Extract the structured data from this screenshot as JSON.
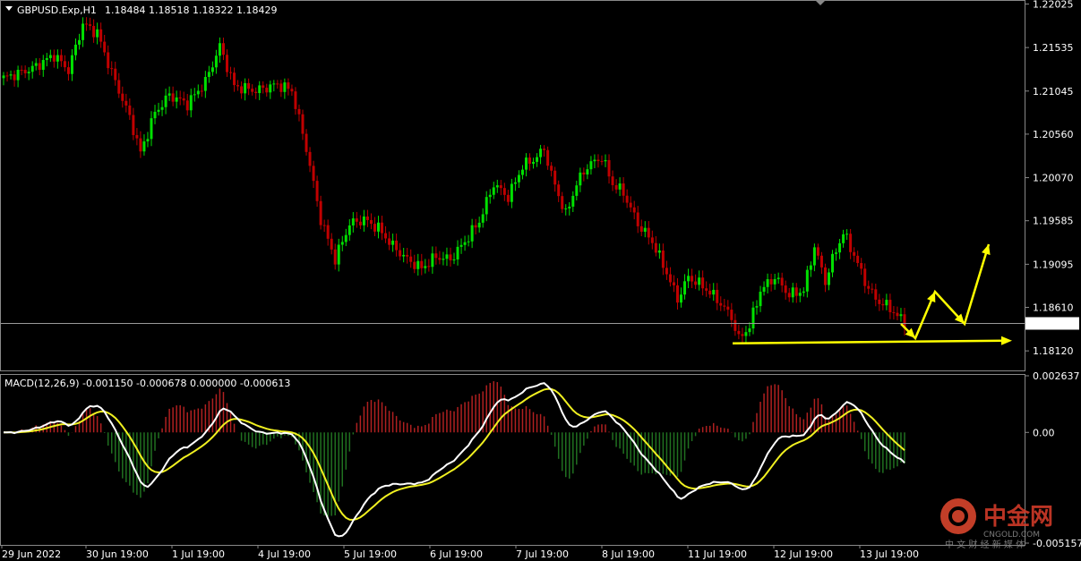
{
  "header": {
    "symbol": "GBPUSD.Exp,H1",
    "ohlc": "1.18484 1.18518 1.18322 1.18429"
  },
  "macd_header": "MACD(12,26,9) -0.001150 -0.000678 0.000000 -0.000613",
  "watermark": {
    "brand_cn": "中金网",
    "brand_en": "CNGOLD.COM",
    "tagline_cn": "中 文 财 经 新 媒 体"
  },
  "colors": {
    "background": "#000000",
    "bull_candle": "#00e000",
    "bear_candle": "#c00000",
    "macd_line": "#ffffff",
    "signal_line": "#f0f020",
    "hist_pos": "#b02020",
    "hist_neg": "#207020",
    "arrows": "#ffff00",
    "watermark": "#e04030"
  },
  "chart_data": [
    {
      "type": "candlestick",
      "title": "GBPUSD.Exp,H1",
      "y_ticks": [
        "1.22025",
        "1.21535",
        "1.21045",
        "1.20560",
        "1.20070",
        "1.19585",
        "1.19095",
        "1.18610",
        "1.18120"
      ],
      "ylim": [
        1.1792,
        1.2205
      ],
      "current_price": "1.18429",
      "x_ticks": [
        "29 Jun 2022",
        "30 Jun 19:00",
        "1 Jul 19:00",
        "4 Jul 19:00",
        "5 Jul 19:00",
        "6 Jul 19:00",
        "7 Jul 19:00",
        "8 Jul 19:00",
        "11 Jul 19:00",
        "12 Jul 19:00",
        "13 Jul 19:00"
      ],
      "anchors": [
        [
          0,
          1.2119
        ],
        [
          8,
          1.213
        ],
        [
          14,
          1.2145
        ],
        [
          18,
          1.2128
        ],
        [
          22,
          1.218
        ],
        [
          26,
          1.217
        ],
        [
          30,
          1.2125
        ],
        [
          35,
          1.2075
        ],
        [
          38,
          1.2035
        ],
        [
          42,
          1.208
        ],
        [
          46,
          1.21
        ],
        [
          51,
          1.209
        ],
        [
          56,
          1.2115
        ],
        [
          60,
          1.2155
        ],
        [
          64,
          1.211
        ],
        [
          70,
          1.2105
        ],
        [
          76,
          1.2112
        ],
        [
          80,
          1.2105
        ],
        [
          84,
          1.204
        ],
        [
          88,
          1.196
        ],
        [
          92,
          1.1915
        ],
        [
          96,
          1.1955
        ],
        [
          100,
          1.196
        ],
        [
          104,
          1.195
        ],
        [
          108,
          1.193
        ],
        [
          112,
          1.1915
        ],
        [
          116,
          1.1905
        ],
        [
          120,
          1.1918
        ],
        [
          124,
          1.1915
        ],
        [
          128,
          1.1935
        ],
        [
          132,
          1.1958
        ],
        [
          136,
          1.2
        ],
        [
          140,
          1.1985
        ],
        [
          144,
          1.202
        ],
        [
          148,
          1.203
        ],
        [
          150,
          1.204
        ],
        [
          152,
          1.201
        ],
        [
          156,
          1.1965
        ],
        [
          159,
          1.2
        ],
        [
          162,
          1.202
        ],
        [
          166,
          1.203
        ],
        [
          169,
          1.2
        ],
        [
          172,
          1.199
        ],
        [
          176,
          1.1955
        ],
        [
          180,
          1.1935
        ],
        [
          184,
          1.19
        ],
        [
          187,
          1.187
        ],
        [
          190,
          1.1895
        ],
        [
          194,
          1.1885
        ],
        [
          198,
          1.187
        ],
        [
          202,
          1.185
        ],
        [
          204,
          1.1825
        ],
        [
          207,
          1.184
        ],
        [
          210,
          1.188
        ],
        [
          214,
          1.1895
        ],
        [
          218,
          1.1875
        ],
        [
          222,
          1.188
        ],
        [
          225,
          1.193
        ],
        [
          228,
          1.189
        ],
        [
          230,
          1.1915
        ],
        [
          233,
          1.1945
        ],
        [
          236,
          1.192
        ],
        [
          239,
          1.189
        ],
        [
          242,
          1.187
        ],
        [
          246,
          1.186
        ],
        [
          250,
          1.1843
        ]
      ],
      "annotations": {
        "support_line_price": 1.18225,
        "projection_path": [
          [
            1006,
            362
          ],
          [
            1022,
            378
          ],
          [
            1044,
            326
          ],
          [
            1077,
            362
          ],
          [
            1104,
            273
          ]
        ]
      }
    },
    {
      "type": "macd",
      "title": "MACD(12,26,9)",
      "params": [
        12,
        26,
        9
      ],
      "values": {
        "macd": -0.00115,
        "signal": -0.000678
      },
      "y_ticks": [
        "0.002637",
        "0.00",
        "-0.005157"
      ],
      "ylim": [
        -0.005157,
        0.002637
      ]
    }
  ]
}
